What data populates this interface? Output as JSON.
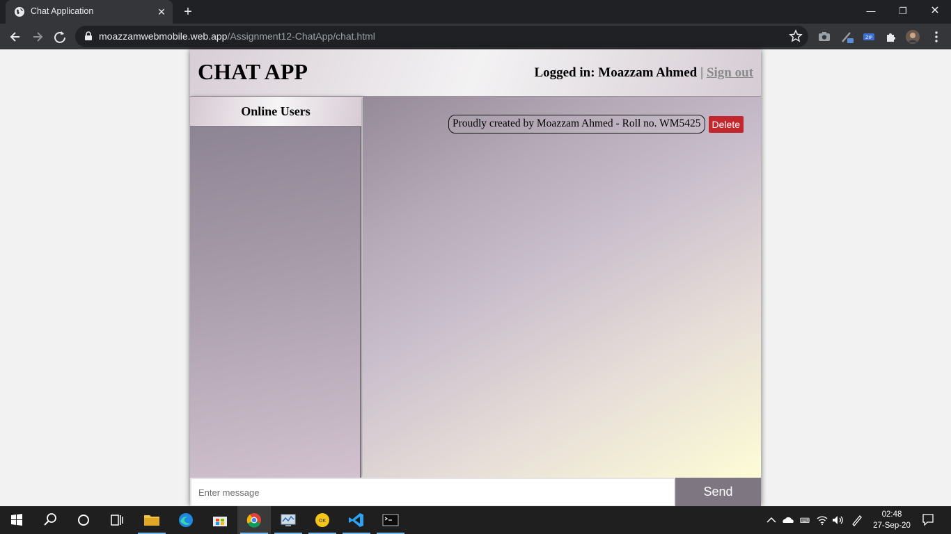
{
  "browser": {
    "tab_title": "Chat Application",
    "url_host": "moazzamwebmobile.web.app",
    "url_path": "/Assignment12-ChatApp/chat.html"
  },
  "app": {
    "title": "CHAT APP",
    "login_label": "Logged in: Moazzam Ahmed",
    "separator": "|",
    "signout_label": "Sign out"
  },
  "sidebar": {
    "title": "Online Users",
    "users": []
  },
  "messages": [
    {
      "text": "Proudly created by Moazzam Ahmed - Roll no. WM5425",
      "delete_label": "Delete"
    }
  ],
  "composer": {
    "placeholder": "Enter message",
    "value": "",
    "send_label": "Send"
  },
  "taskbar": {
    "time": "02:48",
    "date": "27-Sep-20"
  },
  "colors": {
    "delete": "#c3272e",
    "send": "#7e7680",
    "browser_dark": "#202124",
    "browser_toolbar": "#35363a"
  }
}
